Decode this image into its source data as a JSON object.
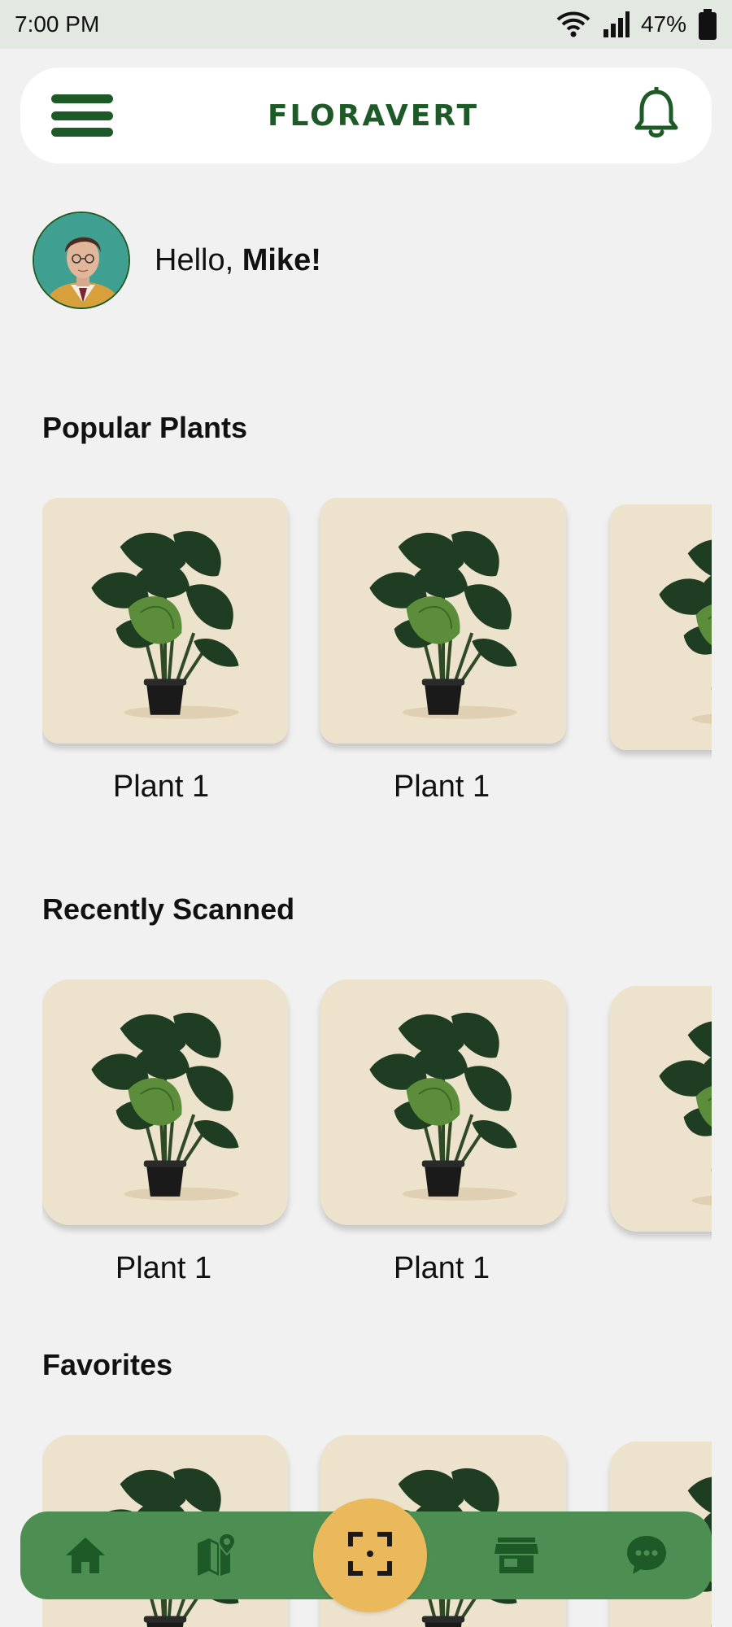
{
  "status_bar": {
    "time": "7:00 PM",
    "battery": "47%",
    "icons": [
      "wifi-icon",
      "signal-icon",
      "battery-icon"
    ]
  },
  "header": {
    "brand": "FLORAVERT",
    "menu_icon": "menu-icon",
    "notification_icon": "bell-icon"
  },
  "greeting": {
    "prefix": "Hello, ",
    "name": "Mike!"
  },
  "sections": {
    "popular": {
      "title": "Popular Plants",
      "items": [
        {
          "label": "Plant 1"
        },
        {
          "label": "Plant 1"
        },
        {
          "label": ""
        }
      ]
    },
    "recent": {
      "title": "Recently Scanned",
      "items": [
        {
          "label": "Plant 1"
        },
        {
          "label": "Plant 1"
        },
        {
          "label": ""
        }
      ]
    },
    "favorites": {
      "title": "Favorites",
      "items": [
        {
          "label": ""
        },
        {
          "label": ""
        },
        {
          "label": ""
        }
      ]
    }
  },
  "bottom_nav": {
    "items": [
      "home-icon",
      "map-icon",
      "scan-icon",
      "store-icon",
      "chat-icon"
    ]
  },
  "colors": {
    "brand_green": "#1e5a27",
    "nav_green": "#4d8f53",
    "scan_accent": "#eab95c",
    "card_bg": "#ede2cc",
    "page_bg": "#f1f1f1"
  }
}
